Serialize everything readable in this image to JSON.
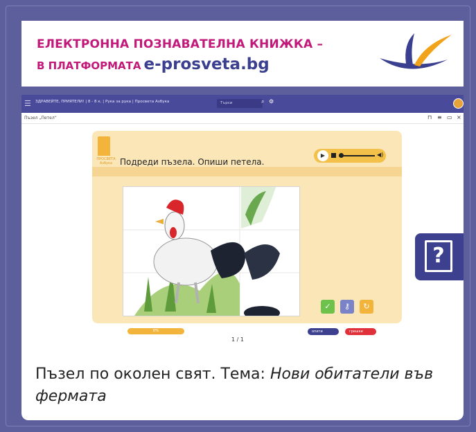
{
  "banner": {
    "line1": "ЕЛЕКТРОННА ПОЗНАВАТЕЛНА КНИЖКА –",
    "line2_prefix": "В ПЛАТФОРМАТА",
    "line2_site": "e-prosveta.bg"
  },
  "app": {
    "breadcrumb": "ЗДРАВЕЙТЕ, ПРИЯТЕЛИ! | 8 - 8 к. | Рука за рука | Просвета Азбука",
    "search_placeholder": "Търси"
  },
  "subbar": {
    "page_title": "Пъзел „Петел“"
  },
  "stage": {
    "book_label": "ПРОСВЕТА Азбука",
    "instruction": "Подреди пъзела. Опиши петела."
  },
  "progress": {
    "label": "0%",
    "value": 0
  },
  "pager": {
    "text": "1 / 1"
  },
  "toggles": {
    "attempts_label": "опити",
    "errors_label": "грешки"
  },
  "help": {
    "symbol": "?"
  },
  "caption": {
    "normal": "Пъзел по околен свят. Тема:",
    "italic": "Нови обитатели във фермата"
  },
  "colors": {
    "background": "#5c5f9c",
    "accent_magenta": "#c2187a",
    "brand_navy": "#3a3f8f",
    "orange": "#f2b43a",
    "check_green": "#6cc24a",
    "hint_purple": "#7a82c8"
  }
}
